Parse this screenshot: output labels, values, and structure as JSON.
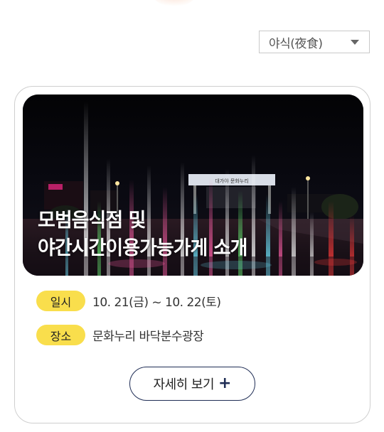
{
  "filter": {
    "selected": "야식(夜食)",
    "icon": "chevron-down-icon"
  },
  "event": {
    "title_line1": "모범음식점 및",
    "title_line2": "야간시간이용가능가게 소개",
    "sign_text": "대가야 문화누리",
    "date_label": "일시",
    "date_value": "10. 21(금) ~ 10. 22(토)",
    "place_label": "장소",
    "place_value": "문화누리 바닥분수광장",
    "more_label": "자세히 보기",
    "more_icon": "plus-icon"
  },
  "colors": {
    "pill": "#f9de4c",
    "button_border": "#1f2d55"
  }
}
